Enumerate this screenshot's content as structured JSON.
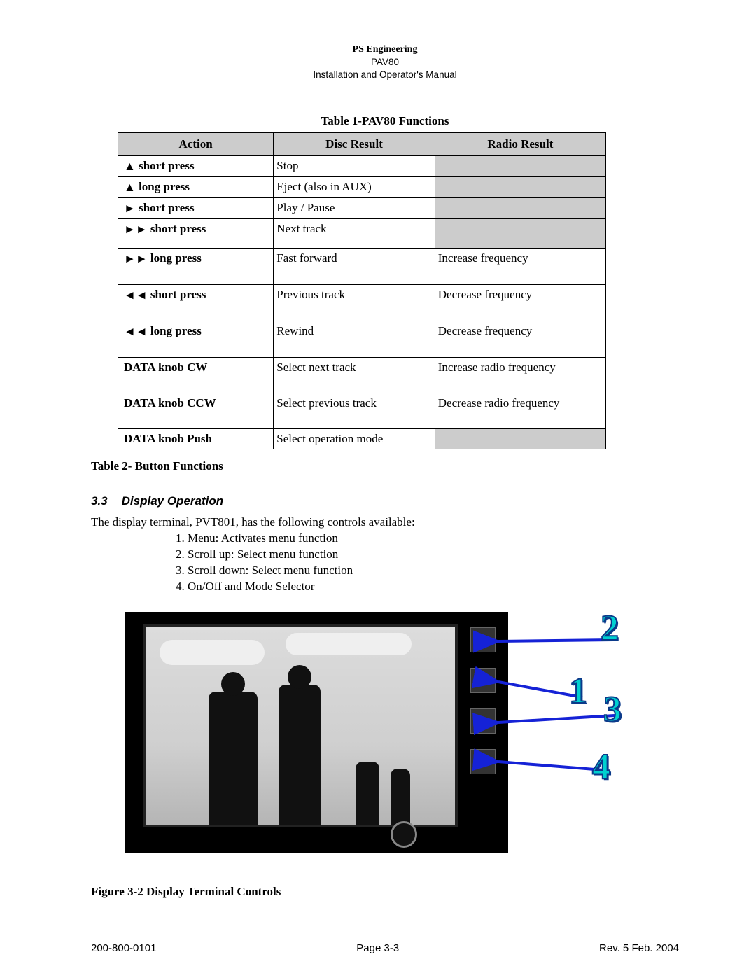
{
  "header": {
    "company": "PS Engineering",
    "model": "PAV80",
    "doc_type": "Installation and Operator's Manual"
  },
  "table1_title": "Table 1-PAV80 Functions",
  "columns": {
    "action": "Action",
    "disc": "Disc Result",
    "radio": "Radio Result"
  },
  "rows": [
    {
      "action_sym": "▲",
      "action_text": " short press",
      "disc": "Stop",
      "radio": "",
      "radio_grey": true,
      "pad": ""
    },
    {
      "action_sym": "▲",
      "action_text": " long press",
      "disc": "Eject (also in AUX)",
      "radio": "",
      "radio_grey": true,
      "pad": ""
    },
    {
      "action_sym": "►",
      "action_text": " short press",
      "disc": "Play / Pause",
      "radio": "",
      "radio_grey": true,
      "pad": ""
    },
    {
      "action_sym": "►►",
      "action_text": " short press",
      "disc": "Next track",
      "radio": "",
      "radio_grey": true,
      "pad": "med"
    },
    {
      "action_sym": "►►",
      "action_text": " long press",
      "disc": "Fast forward",
      "radio": "Increase frequency",
      "radio_grey": false,
      "pad": "tall"
    },
    {
      "action_sym": "◄◄",
      "action_text": " short press",
      "disc": "Previous track",
      "radio": "Decrease frequency",
      "radio_grey": false,
      "pad": "tall"
    },
    {
      "action_sym": "◄◄",
      "action_text": " long press",
      "disc": "Rewind",
      "radio": "Decrease frequency",
      "radio_grey": false,
      "pad": "tall"
    },
    {
      "action_sym": "",
      "action_text": "DATA knob CW",
      "disc": "Select next track",
      "radio": "Increase radio frequency",
      "radio_grey": false,
      "pad": "tall"
    },
    {
      "action_sym": "",
      "action_text": "DATA knob CCW",
      "disc": "Select previous track",
      "radio": "Decrease radio frequency",
      "radio_grey": false,
      "pad": "tall"
    },
    {
      "action_sym": "",
      "action_text": "DATA knob Push",
      "disc": "Select operation mode",
      "radio": "",
      "radio_grey": true,
      "pad": ""
    }
  ],
  "table2_label": "Table 2- Button Functions",
  "section33": {
    "num": "3.3",
    "title": "Display Operation"
  },
  "body_sentence": "The display terminal, PVT801, has the following controls available:",
  "controls_list": [
    "Menu: Activates menu function",
    "Scroll up: Select menu function",
    "Scroll down: Select menu function",
    "On/Off and Mode Selector"
  ],
  "callouts": [
    "1",
    "2",
    "3",
    "4"
  ],
  "figure_caption": "Figure 3-2 Display Terminal Controls",
  "footer": {
    "left": "200-800-0101",
    "center": "Page 3-3",
    "right": "Rev. 5 Feb. 2004"
  }
}
